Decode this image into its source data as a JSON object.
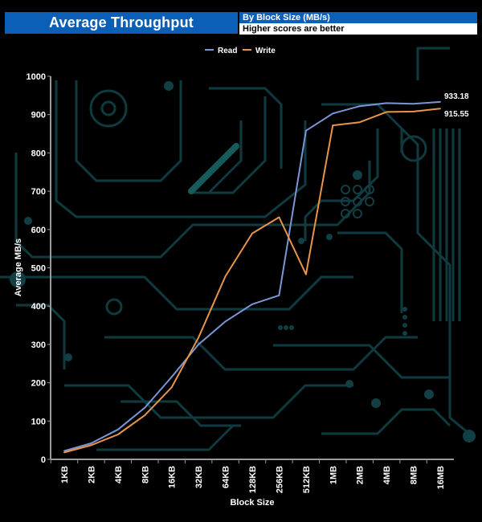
{
  "header": {
    "title": "Average Throughput",
    "subtitle": "By Block Size (MB/s)",
    "note": "Higher scores are better"
  },
  "chart_data": {
    "type": "line",
    "title": "Average Throughput",
    "xlabel": "Block Size",
    "ylabel": "Average MB/s",
    "ylim": [
      0,
      1000
    ],
    "yticks": [
      0,
      100,
      200,
      300,
      400,
      500,
      600,
      700,
      800,
      900,
      1000
    ],
    "legend_position": "top-center",
    "grid": false,
    "categories": [
      "1KB",
      "2KB",
      "4KB",
      "8KB",
      "16KB",
      "32KB",
      "64KB",
      "128KB",
      "256KB",
      "512KB",
      "1MB",
      "2MB",
      "4MB",
      "8MB",
      "16MB"
    ],
    "series": [
      {
        "name": "Read",
        "color": "#7b96d6",
        "values": [
          22,
          42,
          78,
          135,
          215,
          300,
          360,
          405,
          428,
          858,
          903,
          922,
          930,
          928,
          933.18
        ]
      },
      {
        "name": "Write",
        "color": "#e8954a",
        "values": [
          18,
          37,
          65,
          115,
          188,
          318,
          478,
          590,
          632,
          483,
          872,
          880,
          907,
          908,
          915.55
        ]
      }
    ],
    "end_labels": [
      "933.18",
      "915.55"
    ]
  }
}
